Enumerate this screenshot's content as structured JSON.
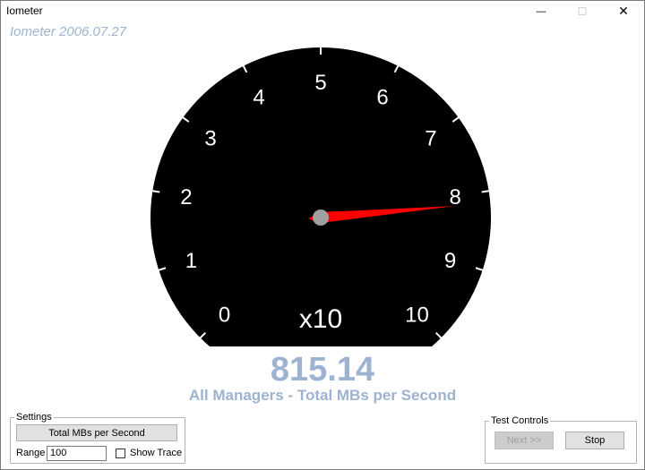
{
  "window": {
    "title": "Iometer",
    "min_glyph": "—",
    "max_glyph": "☐",
    "close_glyph": "✕"
  },
  "header": {
    "version": "Iometer 2006.07.27"
  },
  "gauge": {
    "tick_labels": [
      "0",
      "1",
      "2",
      "3",
      "4",
      "5",
      "6",
      "7",
      "8",
      "9",
      "10"
    ],
    "multiplier": "x10",
    "needle_value_fraction": 0.8151,
    "colors": {
      "dial": "#000000",
      "text": "#ffffff",
      "needle": "#ff0000",
      "hub": "#a0a0a0"
    }
  },
  "readout": {
    "value": "815.14",
    "label": "All Managers - Total MBs per Second",
    "color": "#9db3d1"
  },
  "settings": {
    "group_label": "Settings",
    "metric_button": "Total MBs per Second",
    "range_label": "Range",
    "range_value": "100",
    "show_trace_label": "Show Trace",
    "show_trace_checked": false
  },
  "test_controls": {
    "group_label": "Test Controls",
    "next_label": "Next >>",
    "stop_label": "Stop"
  }
}
